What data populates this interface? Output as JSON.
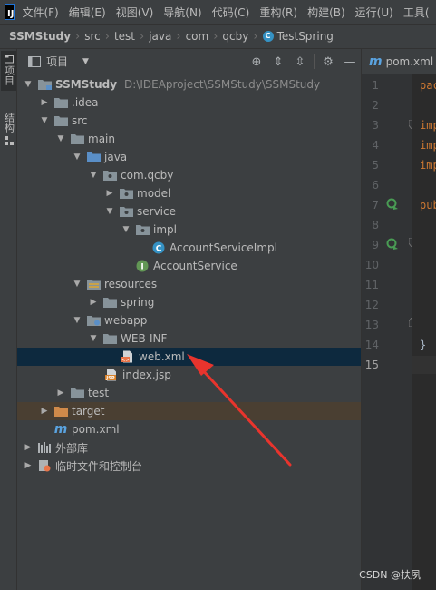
{
  "menu": {
    "logo": "IJ",
    "items": [
      "文件(F)",
      "编辑(E)",
      "视图(V)",
      "导航(N)",
      "代码(C)",
      "重构(R)",
      "构建(B)",
      "运行(U)",
      "工具("
    ]
  },
  "breadcrumb": [
    "SSMStudy",
    "src",
    "test",
    "java",
    "com",
    "qcby",
    "TestSpring"
  ],
  "left_strip": {
    "project_tab": "项目",
    "structure_tab": "结构"
  },
  "project_panel": {
    "title": "项目",
    "tree": [
      {
        "label": "SSMStudy",
        "path": "D:\\IDEAproject\\SSMStudy\\SSMStudy"
      },
      {
        "label": ".idea"
      },
      {
        "label": "src"
      },
      {
        "label": "main"
      },
      {
        "label": "java"
      },
      {
        "label": "com.qcby"
      },
      {
        "label": "model"
      },
      {
        "label": "service"
      },
      {
        "label": "impl"
      },
      {
        "label": "AccountServiceImpl"
      },
      {
        "label": "AccountService"
      },
      {
        "label": "resources"
      },
      {
        "label": "spring"
      },
      {
        "label": "webapp"
      },
      {
        "label": "WEB-INF"
      },
      {
        "label": "web.xml"
      },
      {
        "label": "index.jsp"
      },
      {
        "label": "test"
      },
      {
        "label": "target"
      },
      {
        "label": "pom.xml"
      },
      {
        "label": "外部库"
      },
      {
        "label": "临时文件和控制台"
      }
    ]
  },
  "editor": {
    "tab_label": "pom.xml",
    "line_numbers": [
      "1",
      "2",
      "3",
      "4",
      "5",
      "6",
      "7",
      "8",
      "9",
      "10",
      "11",
      "12",
      "13",
      "14",
      "15"
    ],
    "code_lines": [
      "pac",
      "",
      "imp",
      "imp",
      "imp",
      "",
      "pub",
      "",
      "",
      "",
      "",
      "",
      "",
      "}",
      ""
    ]
  },
  "colors": {
    "selected_row": "#0d293e",
    "excluded_row": "#4a3f32",
    "arrow": "#e8342d",
    "folder": "#87939a",
    "source_folder": "#5a8fc7",
    "excluded_folder": "#d08a4a",
    "keyword": "#cc7832"
  },
  "annotation": {
    "type": "arrow-pointing-to",
    "target": "web.xml"
  },
  "watermark": "CSDN @扶夙"
}
